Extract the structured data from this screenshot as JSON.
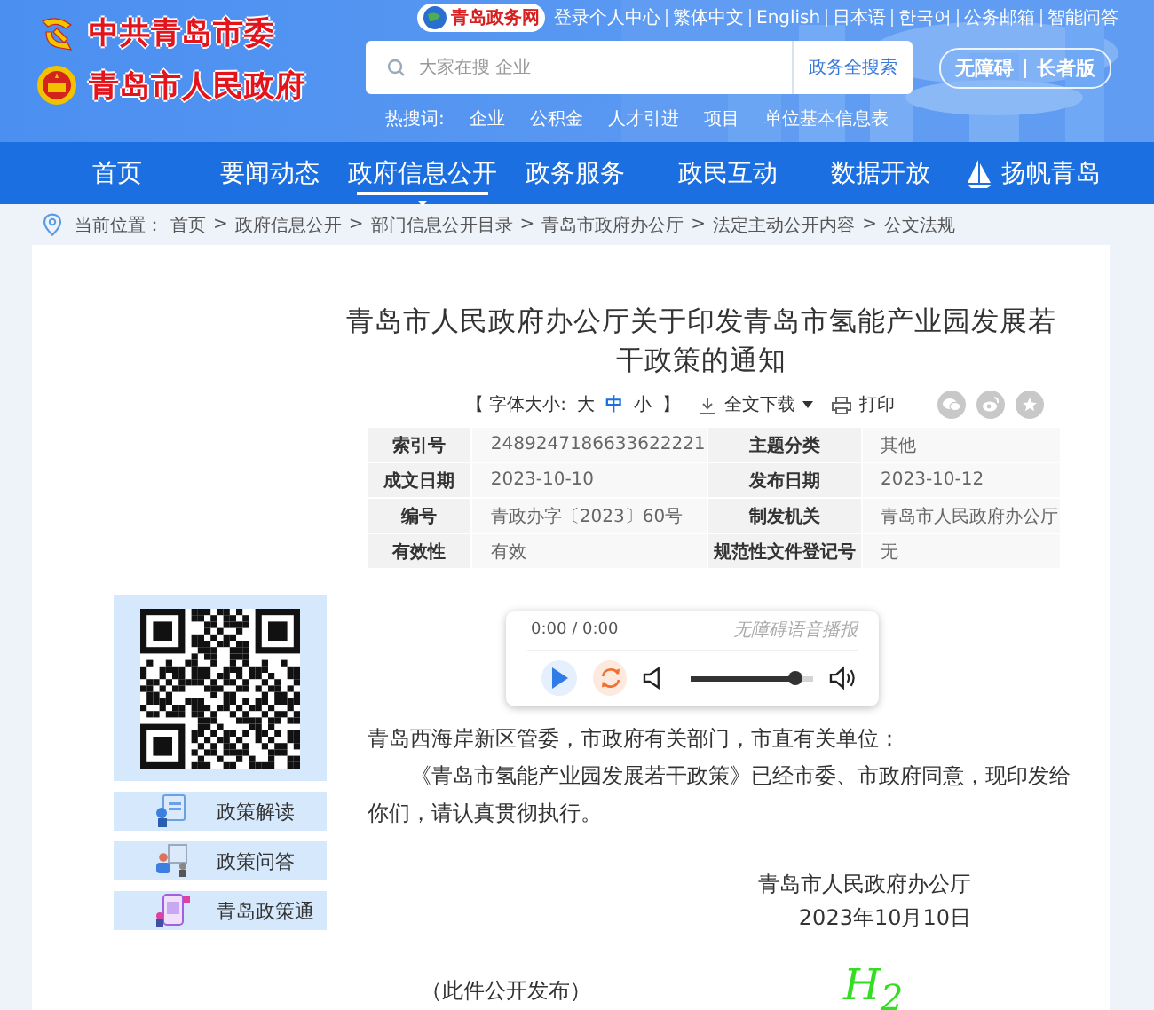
{
  "header": {
    "logos": [
      {
        "kind": "party",
        "text": "中共青岛市委"
      },
      {
        "kind": "government",
        "text": "青岛市人民政府"
      }
    ],
    "portal_logo": "青岛政务网",
    "top_links": [
      "登录个人中心",
      "繁体中文",
      "English",
      "日本语",
      "한국어",
      "公务邮箱",
      "智能问答"
    ],
    "search": {
      "placeholder": "大家在搜 企业",
      "button": "政务全搜索"
    },
    "hot_words": {
      "label": "热搜词:",
      "words": [
        "企业",
        "公积金",
        "人才引进",
        "项目",
        "单位基本信息表"
      ]
    },
    "mode_buttons": [
      "无障碍",
      "长者版"
    ]
  },
  "nav": [
    {
      "label": "首页",
      "selected": false
    },
    {
      "label": "要闻动态",
      "selected": false
    },
    {
      "label": "政府信息公开",
      "selected": true
    },
    {
      "label": "政务服务",
      "selected": false
    },
    {
      "label": "政民互动",
      "selected": false
    },
    {
      "label": "数据开放",
      "selected": false
    },
    {
      "label": "扬帆青岛",
      "selected": false,
      "kind": "sail"
    }
  ],
  "breadcrumb": {
    "label": "当前位置：",
    "items": [
      {
        "text": "首页"
      },
      {
        "sep": ">",
        "text": "政府信息公开"
      },
      {
        "sep": ">",
        "text": "部门信息公开目录"
      },
      {
        "sep": ">",
        "text": "青岛市政府办公厅"
      },
      {
        "sep": ">",
        "text": "法定主动公开内容"
      },
      {
        "sep": ">",
        "text": "公文法规"
      }
    ]
  },
  "article": {
    "title": "青岛市人民政府办公厅关于印发青岛市氢能产业园发展若干政策的通知",
    "font_size": {
      "open": "【 字体大小:",
      "options": [
        {
          "label": "大",
          "selected": false
        },
        {
          "label": "中",
          "selected": true
        },
        {
          "label": "小",
          "selected": false
        }
      ],
      "close": "】"
    },
    "download": "全文下载",
    "print": "打印",
    "info": [
      [
        {
          "label": "索引号",
          "value": "2489247186633622221"
        },
        {
          "label": "主题分类",
          "value": "其他"
        }
      ],
      [
        {
          "label": "成文日期",
          "value": "2023-10-10"
        },
        {
          "label": "发布日期",
          "value": "2023-10-12"
        }
      ],
      [
        {
          "label": "编号",
          "value": "青政办字〔2023〕60号"
        },
        {
          "label": "制发机关",
          "value": "青岛市人民政府办公厅"
        }
      ],
      [
        {
          "label": "有效性",
          "value": "有效"
        },
        {
          "label": "规范性文件登记号",
          "value": "无"
        }
      ]
    ],
    "audio": {
      "time": "0:00 / 0:00",
      "caption": "无障碍语音播报"
    },
    "paragraphs": [
      {
        "kind": "salutation",
        "text": "青岛西海岸新区管委，市政府有关部门，市直有关单位："
      },
      {
        "kind": "body",
        "text": "《青岛市氢能产业园发展若干政策》已经市委、市政府同意，现印发给你们，请认真贯彻执行。"
      }
    ],
    "signature": "青岛市人民政府办公厅",
    "date": "2023年10月10日",
    "note": "（此件公开发布）",
    "formula": "H$_{2}$"
  },
  "sidebar": {
    "links": [
      "政策解读",
      "政策问答",
      "青岛政策通"
    ]
  }
}
